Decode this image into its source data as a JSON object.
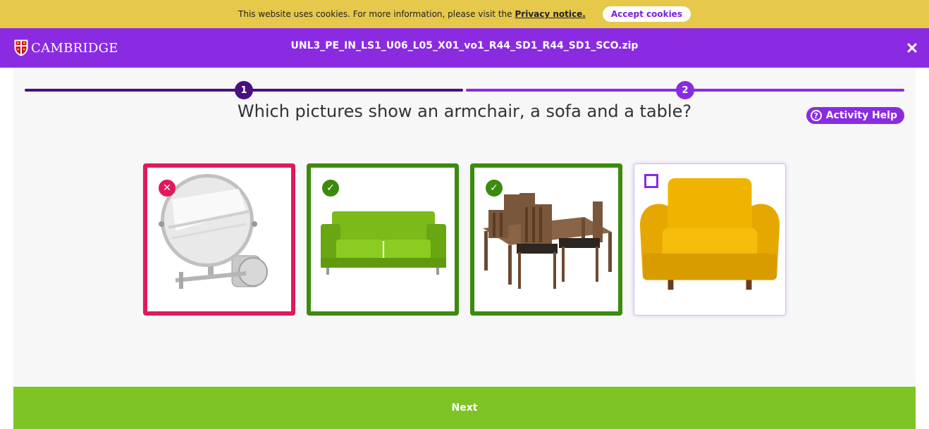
{
  "cookie_bar": {
    "message": "This website uses cookies. For more information, please visit the",
    "link_label": "Privacy notice.",
    "accept_label": "Accept cookies"
  },
  "header": {
    "logo_text": "CAMBRIDGE",
    "file_title": "UNL3_PE_IN_LS1_U06_L05_X01_vo1_R44_SD1_R44_SD1_SCO.zip",
    "close_icon": "close-icon"
  },
  "progress": {
    "steps": [
      {
        "number": "1",
        "state": "completed"
      },
      {
        "number": "2",
        "state": "current"
      }
    ]
  },
  "activity": {
    "question": "Which pictures show an armchair, a sofa and a table?",
    "help_label": "Activity Help",
    "cards": [
      {
        "subject": "mirror",
        "state": "incorrect",
        "badge_icon": "cross-icon"
      },
      {
        "subject": "sofa",
        "state": "correct",
        "badge_icon": "check-icon"
      },
      {
        "subject": "table and chairs",
        "state": "correct",
        "badge_icon": "check-icon"
      },
      {
        "subject": "armchair",
        "state": "unselected",
        "badge_icon": "checkbox-icon"
      }
    ]
  },
  "footer": {
    "next_label": "Next"
  },
  "colors": {
    "cookie_bar": "#e6c84a",
    "header": "#8a2be2",
    "progress_done": "#4a0f82",
    "incorrect": "#e0195a",
    "correct": "#3c8a0e",
    "next_bar": "#7dc424"
  }
}
